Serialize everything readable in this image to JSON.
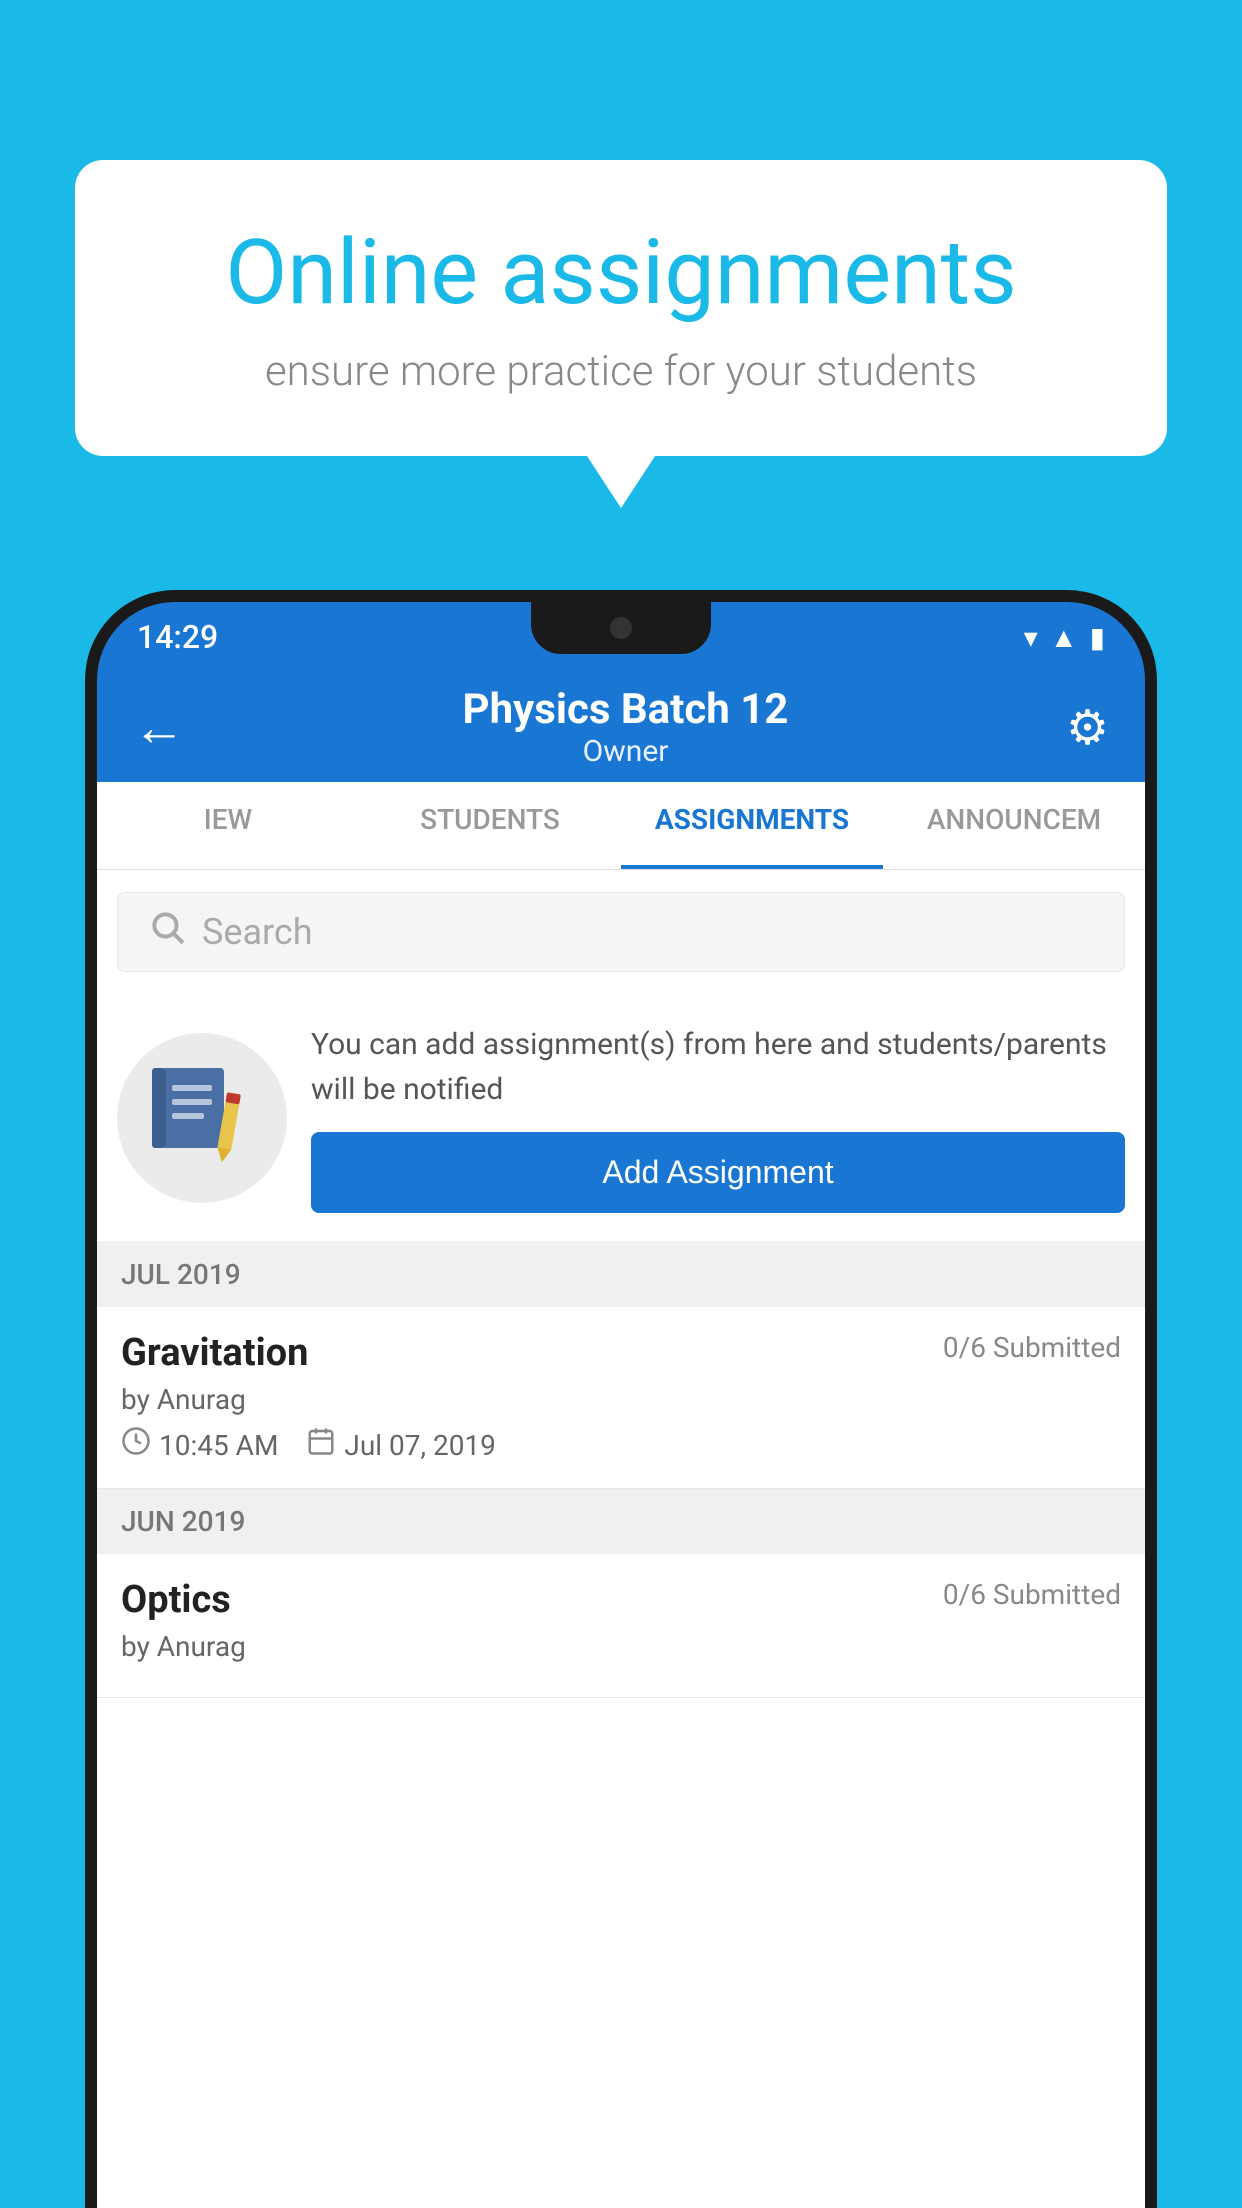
{
  "background_color": "#1ab9e8",
  "speech_bubble": {
    "title": "Online assignments",
    "subtitle": "ensure more practice for your students"
  },
  "status_bar": {
    "time": "14:29",
    "wifi": "▾",
    "signal": "▴",
    "battery": "▮"
  },
  "app_bar": {
    "title": "Physics Batch 12",
    "subtitle": "Owner",
    "back_label": "←",
    "settings_label": "⚙"
  },
  "tabs": [
    {
      "label": "IEW",
      "active": false
    },
    {
      "label": "STUDENTS",
      "active": false
    },
    {
      "label": "ASSIGNMENTS",
      "active": true
    },
    {
      "label": "ANNOUNCEM",
      "active": false
    }
  ],
  "search": {
    "placeholder": "Search"
  },
  "add_assignment_section": {
    "description": "You can add assignment(s) from here and students/parents will be notified",
    "button_label": "Add Assignment"
  },
  "sections": [
    {
      "header": "JUL 2019",
      "items": [
        {
          "title": "Gravitation",
          "submitted": "0/6 Submitted",
          "by": "by Anurag",
          "time": "10:45 AM",
          "date": "Jul 07, 2019"
        }
      ]
    },
    {
      "header": "JUN 2019",
      "items": [
        {
          "title": "Optics",
          "submitted": "0/6 Submitted",
          "by": "by Anurag",
          "time": "",
          "date": ""
        }
      ]
    }
  ]
}
